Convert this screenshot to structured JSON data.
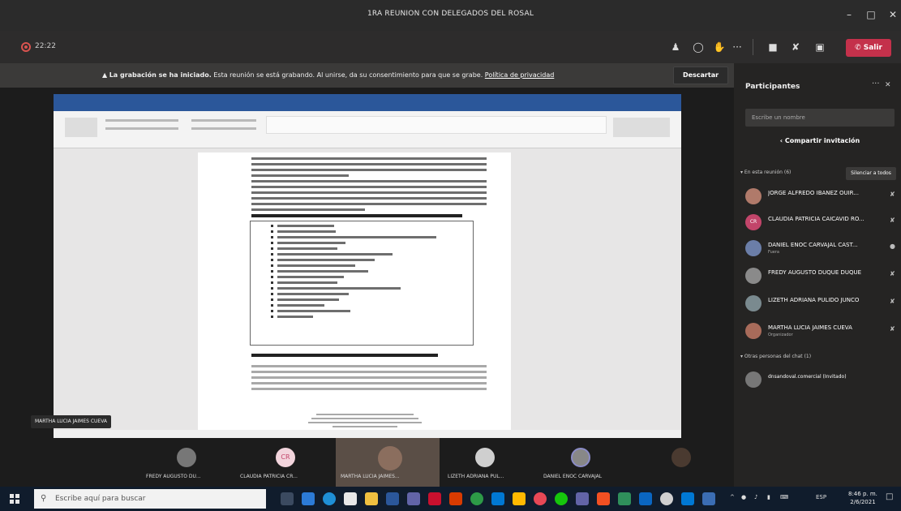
{
  "window": {
    "title": "1RA REUNION CON DELEGADOS DEL ROSAL",
    "controls": [
      "–",
      "□",
      "✕"
    ]
  },
  "toolbar": {
    "timer": "22:22",
    "leave_label": "Salir"
  },
  "banner": {
    "bold": "La grabación se ha iniciado.",
    "text": "Esta reunión se está grabando. Al unirse, da su consentimiento para que se grabe.",
    "link": "Política de privacidad",
    "dismiss_label": "Descartar"
  },
  "share": {
    "presenter_tag": "MARTHA LUCIA JAIMES CUEVA"
  },
  "panel": {
    "title": "Participantes",
    "search_placeholder": "Escribe un nombre",
    "invite_label": "Compartir invitación",
    "in_meeting_label": "En esta reunión (6)",
    "mute_all_label": "Silenciar a todos",
    "participants": [
      {
        "name": "JORGE ALFREDO IBAÑEZ OUIR...",
        "role": "",
        "initials": "",
        "color": "#b07a6a"
      },
      {
        "name": "CLAUDIA PATRICIA CAICAVID RO...",
        "role": "",
        "initials": "CR",
        "color": "#c2456a"
      },
      {
        "name": "DANIEL ENOC CARVAJAL CAST...",
        "role": "Fuera",
        "initials": "",
        "color": "#6b7ea8"
      },
      {
        "name": "FREDY AUGUSTO DUQUE DUQUE",
        "role": "",
        "initials": "",
        "color": "#8a8a8a"
      },
      {
        "name": "LIZETH ADRIANA PULIDO JUNCO",
        "role": "",
        "initials": "",
        "color": "#7a8a8f"
      },
      {
        "name": "MARTHA LUCIA JAIMES CUEVA",
        "role": "Organizador",
        "initials": "",
        "color": "#a86b5a"
      }
    ],
    "others_label": "Otras personas del chat (1)",
    "others": [
      {
        "name": "dnsandoval.comercial (Invitado)"
      }
    ]
  },
  "strip": {
    "tiles": [
      {
        "name": "FREDY AUGUSTO DU..."
      },
      {
        "name": "CLAUDIA PATRICIA CR...",
        "initials": "CR"
      },
      {
        "name": "MARTHA LUCIA JAIMES..."
      },
      {
        "name": "LIZETH ADRIANA PUL..."
      },
      {
        "name": "DANIEL ENOC CARVAJAL"
      }
    ]
  },
  "taskbar": {
    "search_placeholder": "Escribe aquí para buscar",
    "lang": "ESP",
    "time": "8:46 p. m.",
    "date": "2/6/2021"
  }
}
